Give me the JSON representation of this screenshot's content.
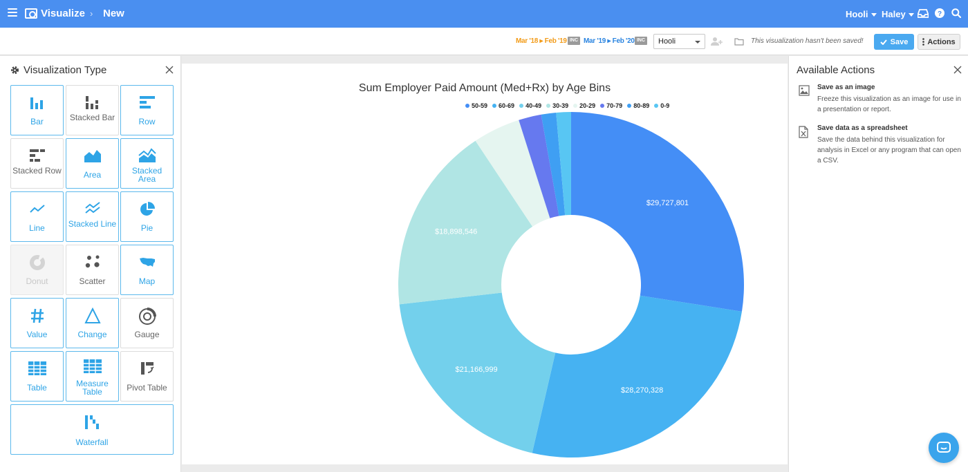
{
  "topbar": {
    "app_title": "Visualize",
    "crumb_sep": "›",
    "crumb": "New",
    "org_menu": "Hooli",
    "user_menu": "Haley"
  },
  "toolbar": {
    "range_primary": "Mar '18 ▸ Feb '19",
    "range_compare": "Mar '19 ▸ Feb '20",
    "inc_badge": "INC",
    "org_select": "Hooli",
    "unsaved_text": "This visualization hasn't been saved!",
    "save_label": "Save",
    "actions_label": "Actions"
  },
  "viz_panel": {
    "title": "Visualization Type",
    "types": [
      {
        "label": "Bar"
      },
      {
        "label": "Stacked Bar"
      },
      {
        "label": "Row"
      },
      {
        "label": "Stacked Row"
      },
      {
        "label": "Area"
      },
      {
        "label": "Stacked Area"
      },
      {
        "label": "Line"
      },
      {
        "label": "Stacked Line"
      },
      {
        "label": "Pie"
      },
      {
        "label": "Donut"
      },
      {
        "label": "Scatter"
      },
      {
        "label": "Map"
      },
      {
        "label": "Value"
      },
      {
        "label": "Change"
      },
      {
        "label": "Gauge"
      },
      {
        "label": "Table"
      },
      {
        "label": "Measure Table"
      },
      {
        "label": "Pivot Table"
      },
      {
        "label": "Waterfall"
      }
    ]
  },
  "chart_data": {
    "type": "pie",
    "title": "Sum Employer Paid Amount (Med+Rx) by Age Bins",
    "labels": [
      "50-59",
      "60-69",
      "40-49",
      "30-39",
      "20-29",
      "70-79",
      "80-89",
      "0-9"
    ],
    "values": [
      29727801,
      28270328,
      21166999,
      18898546,
      4800000,
      2300000,
      1500000,
      1500000
    ],
    "data_labels": [
      "$29,727,801",
      "$28,270,328",
      "$21,166,999",
      "$18,898,546",
      "",
      "",
      "",
      ""
    ],
    "colors": [
      "#448ef6",
      "#46b2f2",
      "#73d0ec",
      "#b0e5e4",
      "#e5f5f0",
      "#6679ef",
      "#3f9ff3",
      "#58c6f3"
    ],
    "legend_placement": "top"
  },
  "actions_panel": {
    "title": "Available Actions",
    "items": [
      {
        "heading": "Save as an image",
        "desc": "Freeze this visualization as an image for use in a presentation or report."
      },
      {
        "heading": "Save data as a spreadsheet",
        "desc": "Save the data behind this visualization for analysis in Excel or any program that can open a CSV."
      }
    ]
  }
}
